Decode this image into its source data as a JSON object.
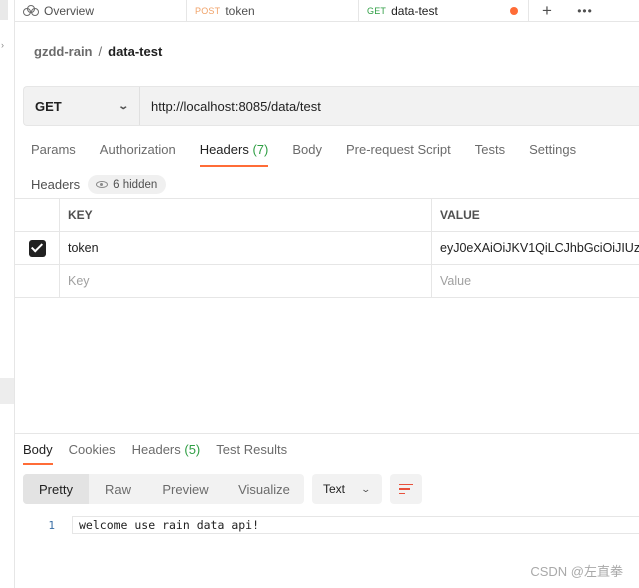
{
  "tabs": {
    "overview": "Overview",
    "token": {
      "method": "POST",
      "name": "token"
    },
    "data_test": {
      "method": "GET",
      "name": "data-test"
    }
  },
  "breadcrumb": {
    "parent": "gzdd-rain",
    "separator": "/",
    "current": "data-test"
  },
  "request": {
    "method": "GET",
    "url": "http://localhost:8085/data/test"
  },
  "request_tabs": [
    {
      "label": "Params"
    },
    {
      "label": "Authorization"
    },
    {
      "label": "Headers",
      "count": "(7)"
    },
    {
      "label": "Body"
    },
    {
      "label": "Pre-request Script"
    },
    {
      "label": "Tests"
    },
    {
      "label": "Settings"
    }
  ],
  "headers_section": {
    "title": "Headers",
    "hidden": "6 hidden"
  },
  "headers_table": {
    "columns": [
      "KEY",
      "VALUE"
    ],
    "rows": [
      {
        "key": "token",
        "value": "eyJ0eXAiOiJKV1QiLCJhbGciOiJIUzI"
      }
    ],
    "key_placeholder": "Key",
    "value_placeholder": "Value"
  },
  "response_tabs": [
    {
      "label": "Body"
    },
    {
      "label": "Cookies"
    },
    {
      "label": "Headers",
      "count": "(5)"
    },
    {
      "label": "Test Results"
    }
  ],
  "view_modes": [
    "Pretty",
    "Raw",
    "Preview",
    "Visualize"
  ],
  "format": "Text",
  "body_lines": [
    {
      "no": "1",
      "text": "welcome use rain data api!"
    }
  ],
  "watermark": "CSDN @左直拳",
  "colors": {
    "accent": "#ff6c37",
    "get": "#2f9e44",
    "post": "#f0a268"
  }
}
